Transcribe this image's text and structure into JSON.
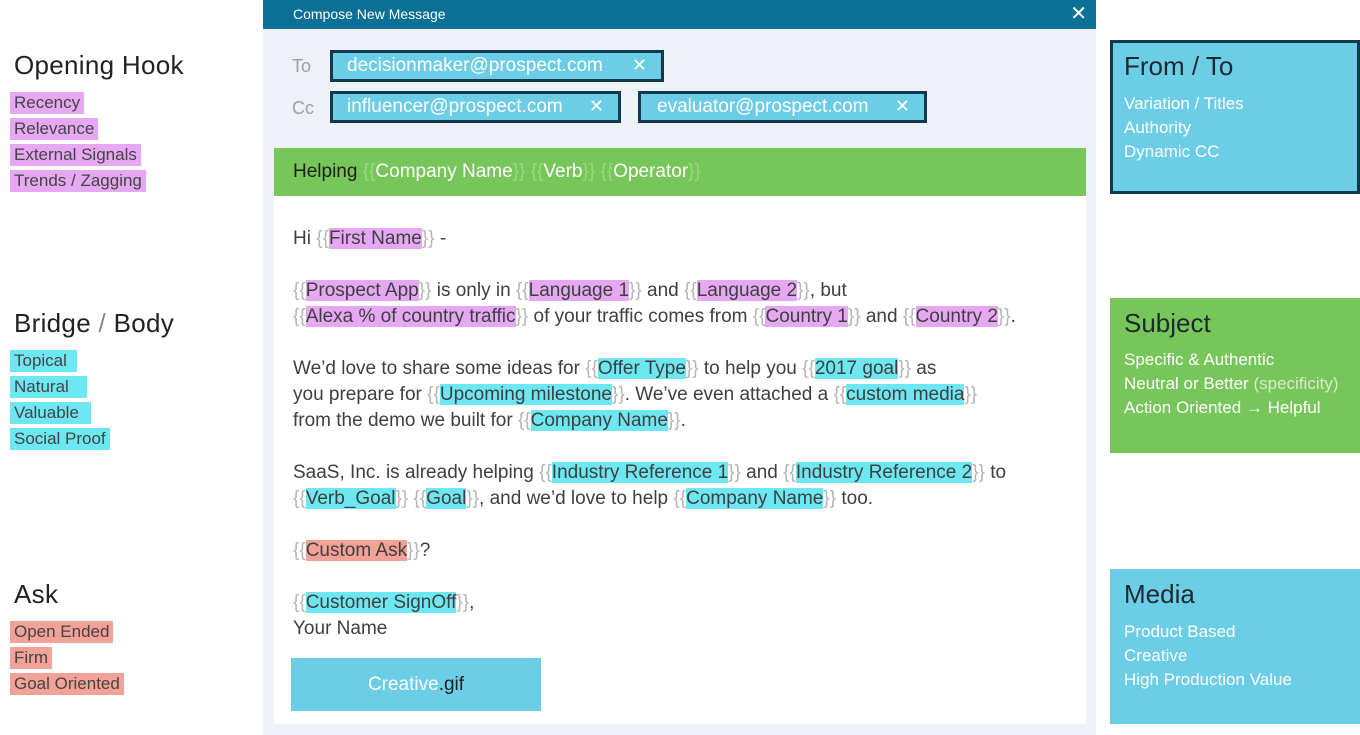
{
  "left": {
    "opening": {
      "title": "Opening Hook",
      "items": [
        "Recency",
        "Relevance",
        "External Signals",
        "Trends / Zagging"
      ]
    },
    "bridge": {
      "title_a": "Bridge",
      "sep": "/",
      "title_b": "Body",
      "items": [
        "Topical",
        "Natural",
        "Valuable",
        "Social Proof"
      ]
    },
    "ask": {
      "title": "Ask",
      "items": [
        "Open Ended",
        "Firm",
        "Goal Oriented"
      ]
    }
  },
  "compose": {
    "title": "Compose New Message",
    "close": "✕",
    "to_label": "To",
    "cc_label": "Cc",
    "to": [
      {
        "email": "decisionmaker@prospect.com"
      }
    ],
    "cc": [
      {
        "email": "influencer@prospect.com"
      },
      {
        "email": "evaluator@prospect.com"
      }
    ],
    "chip_remove": "✕",
    "subject": {
      "prefix": "Helping",
      "vars": [
        "Company Name",
        "Verb",
        "Operator"
      ]
    },
    "body": {
      "greet_pre": "Hi ",
      "greet_var": "First Name",
      "greet_post": " -",
      "p1a_v1": "Prospect App",
      "p1a_t1": " is only in ",
      "p1a_v2": "Language 1",
      "p1a_t2": " and ",
      "p1a_v3": "Language 2",
      "p1a_t3": ", but",
      "p1b_v1": "Alexa % of country traffic",
      "p1b_t1": " of your traffic comes from ",
      "p1b_v2": "Country 1",
      "p1b_t2": " and ",
      "p1b_v3": "Country 2",
      "p1b_t3": ".",
      "p2a_t0": "We’d love to share some ideas for ",
      "p2a_v1": "Offer Type",
      "p2a_t1": " to help you ",
      "p2a_v2": "2017 goal",
      "p2a_t2": " as",
      "p2b_t0": "you prepare for ",
      "p2b_v1": "Upcoming milestone",
      "p2b_t1": ". We’ve even attached a ",
      "p2b_v2": "custom media",
      "p2c_t0": "from the demo we built for ",
      "p2c_v1": "Company Name",
      "p2c_t1": ".",
      "p3a_t0": "SaaS, Inc. is already helping ",
      "p3a_v1": "Industry Reference 1",
      "p3a_t1": " and ",
      "p3a_v2": "Industry Reference 2",
      "p3a_t2": " to",
      "p3b_v1": "Verb_Goal",
      "p3b_v2": "Goal",
      "p3b_t1": ", and we’d love to help ",
      "p3b_v3": "Company Name",
      "p3b_t2": " too.",
      "ask_var": "Custom Ask",
      "ask_post": "?",
      "signoff_var": "Customer SignOff",
      "signoff_post": ",",
      "name": "Your Name"
    },
    "attachment": {
      "name": "Creative",
      "ext": ".gif"
    }
  },
  "right": {
    "fromto": {
      "title": "From / To",
      "items": [
        "Variation / Titles",
        "Authority",
        "Dynamic CC"
      ]
    },
    "subject": {
      "title": "Subject",
      "items": [
        "Specific & Authentic",
        "Neutral or Better",
        "(specificity)",
        "Action Oriented → Helpful"
      ]
    },
    "media": {
      "title": "Media",
      "items": [
        "Product Based",
        "Creative",
        "High Production Value"
      ]
    }
  },
  "colors": {
    "header": "#0a7096",
    "subject_bar": "#77c65a",
    "chip": "#6ccde6",
    "hook": "#e6a8f2",
    "body": "#6de8f2",
    "ask": "#f4a198",
    "media_box": "#6ccde6"
  }
}
